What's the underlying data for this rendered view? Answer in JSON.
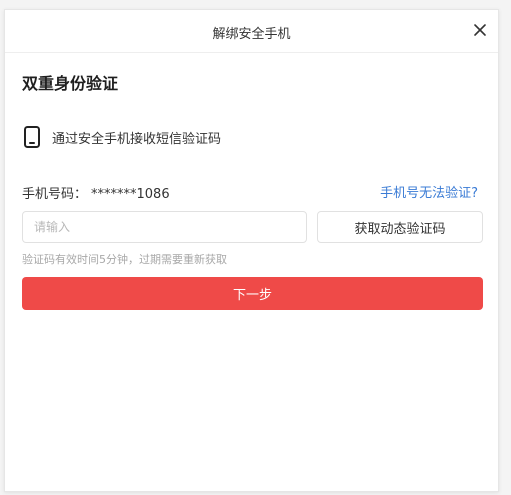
{
  "dialog": {
    "title": "解绑安全手机",
    "close_icon": "close-icon"
  },
  "verification": {
    "heading": "双重身份验证",
    "method_icon": "mobile-phone-icon",
    "method_label": "通过安全手机接收短信验证码",
    "phone_label": "手机号码：",
    "phone_number": "*******1086",
    "cannot_verify_link": "手机号无法验证?",
    "code_input": {
      "value": "",
      "placeholder": "请输入"
    },
    "get_code_button": "获取动态验证码",
    "hint": "验证码有效时间5分钟，过期需要重新获取",
    "next_button": "下一步"
  },
  "colors": {
    "primary_button": "#ef4a48",
    "link": "#3a7bd5",
    "hint_text": "#a8a8a8"
  }
}
